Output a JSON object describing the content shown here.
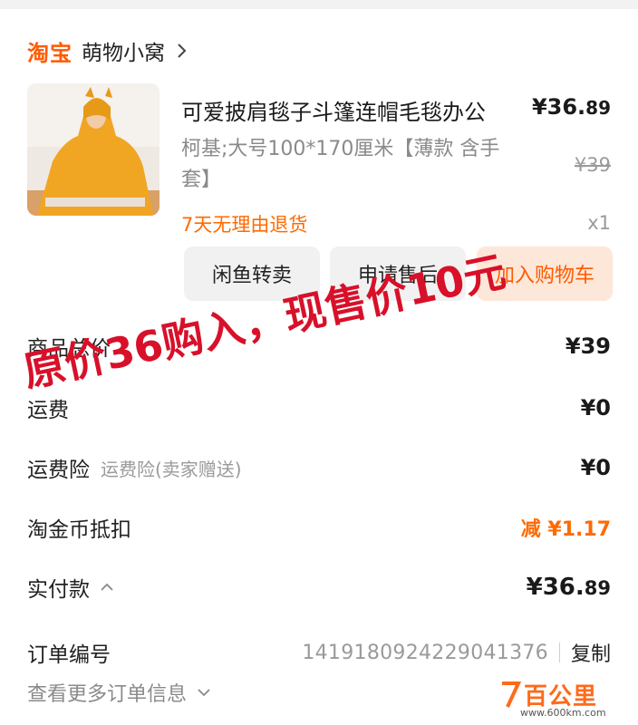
{
  "shop": {
    "logo": "淘宝",
    "name": "萌物小窝"
  },
  "product": {
    "title": "可爱披肩毯子斗篷连帽毛毯办公",
    "price_main": "¥36.",
    "price_dec": "89",
    "spec": "柯基;大号100*170厘米【薄款 含手套】",
    "original_price": "¥39",
    "return_policy": "7天无理由退货",
    "quantity": "x1"
  },
  "actions": {
    "resell": "闲鱼转卖",
    "after_sale": "申请售后",
    "add_cart": "加入购物车"
  },
  "summary": {
    "total_label": "商品总价",
    "total_value": "¥39",
    "shipping_label": "运费",
    "shipping_value": "¥0",
    "insurance_label": "运费险",
    "insurance_sub": "运费险(卖家赠送)",
    "insurance_value": "¥0",
    "coin_label": "淘金币抵扣",
    "coin_value": "减 ¥1.17",
    "paid_label": "实付款",
    "paid_main": "¥36.",
    "paid_dec": "89",
    "order_label": "订单编号",
    "order_number": "1419180924229041376",
    "copy_label": "复制",
    "more_label": "查看更多订单信息"
  },
  "overlay": {
    "text": "原价36购入，现售价10元",
    "color": "#d8102a"
  },
  "watermark": {
    "name": "百公里",
    "url": "www.600km.com"
  },
  "colors": {
    "accent": "#ff5a00",
    "orange_text": "#ff6a00",
    "muted": "#8a8a8a"
  }
}
